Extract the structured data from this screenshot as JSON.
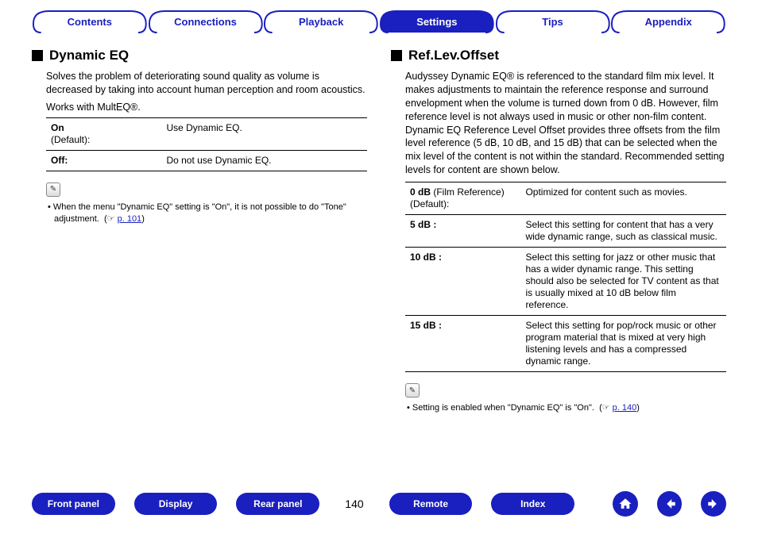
{
  "tabs": {
    "contents": "Contents",
    "connections": "Connections",
    "playback": "Playback",
    "settings": "Settings",
    "tips": "Tips",
    "appendix": "Appendix",
    "active": "settings"
  },
  "left": {
    "title": "Dynamic EQ",
    "desc": "Solves the problem of deteriorating sound quality as volume is decreased by taking into account human perception and room acoustics.",
    "works": "Works with MultEQ®.",
    "rows": [
      {
        "key_bold": "On",
        "key_rest": "\n(Default):",
        "val": "Use Dynamic EQ."
      },
      {
        "key_bold": "Off:",
        "key_rest": "",
        "val": "Do not use Dynamic EQ."
      }
    ],
    "note": "When the menu \"Dynamic EQ\" setting is \"On\", it is not possible to do \"Tone\" adjustment.",
    "note_link_prefix": "(☞ ",
    "note_link": "p. 101",
    "note_link_suffix": ")"
  },
  "right": {
    "title": "Ref.Lev.Offset",
    "desc": "Audyssey Dynamic EQ® is referenced to the standard film mix level. It makes adjustments to maintain the reference response and surround envelopment when the volume is turned down from 0 dB. However, film reference level is not always used in music or other non-film content. Dynamic EQ Reference Level Offset provides three offsets from the film level reference (5 dB, 10 dB, and 15 dB) that can be selected when the mix level of the content is not within the standard. Recommended setting levels for content are shown below.",
    "rows": [
      {
        "key_bold": "0 dB",
        "key_rest": " (Film Reference)\n(Default):",
        "val": "Optimized for content such as movies."
      },
      {
        "key_bold": "5 dB :",
        "key_rest": "",
        "val": "Select this setting for content that has a very wide dynamic range, such as classical music."
      },
      {
        "key_bold": "10 dB :",
        "key_rest": "",
        "val": "Select this setting for jazz or other music that has a wider dynamic range. This setting should also be selected for TV content as that is usually mixed at 10 dB below film reference."
      },
      {
        "key_bold": "15 dB :",
        "key_rest": "",
        "val": "Select this setting for pop/rock music or other program material that is mixed at very high listening levels and has a compressed dynamic range."
      }
    ],
    "note": "Setting is enabled when \"Dynamic EQ\" is \"On\".",
    "note_link_prefix": "(☞ ",
    "note_link": "p. 140",
    "note_link_suffix": ")"
  },
  "bottom": {
    "front": "Front panel",
    "display": "Display",
    "rear": "Rear panel",
    "page": "140",
    "remote": "Remote",
    "index": "Index"
  }
}
